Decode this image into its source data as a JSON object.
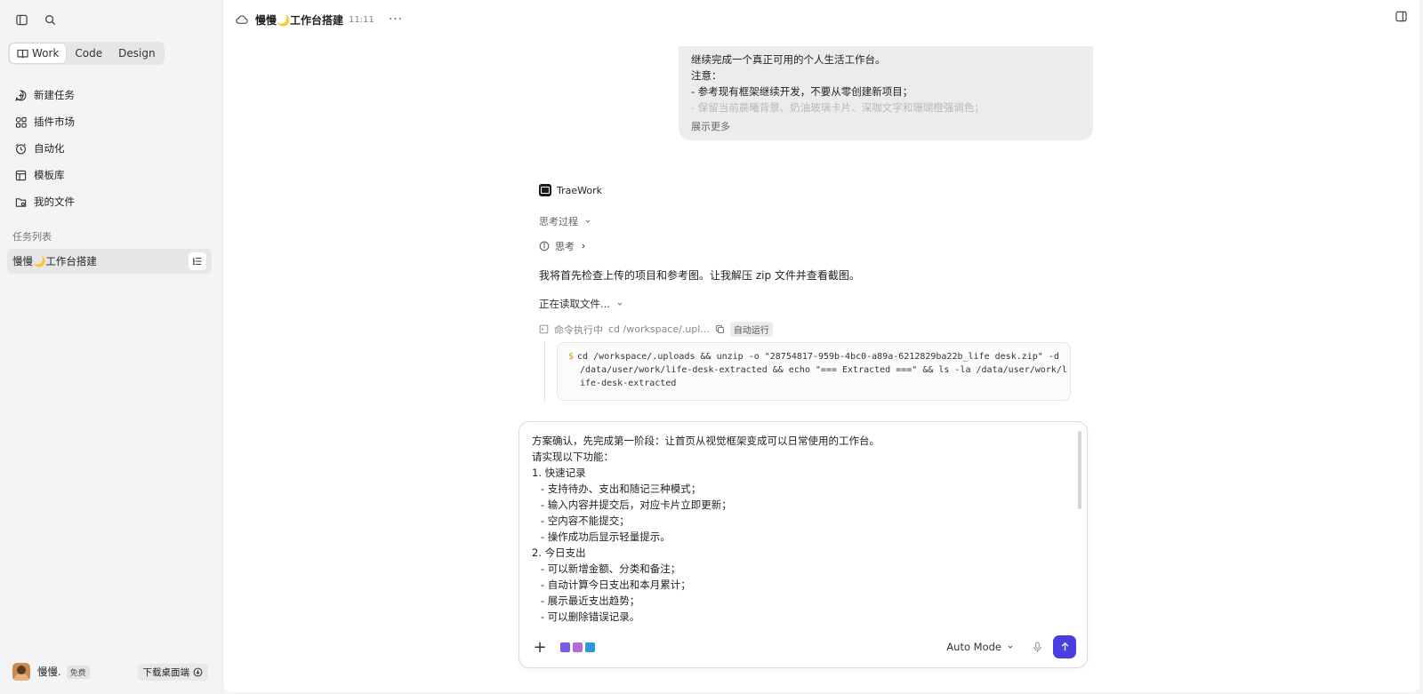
{
  "sidebar": {
    "tabs": [
      {
        "label": "Work",
        "active": true
      },
      {
        "label": "Code",
        "active": false
      },
      {
        "label": "Design",
        "active": false
      }
    ],
    "nav": [
      {
        "label": "新建任务",
        "icon": "new-task-icon"
      },
      {
        "label": "插件市场",
        "icon": "plugin-icon"
      },
      {
        "label": "自动化",
        "icon": "clock-icon"
      },
      {
        "label": "模板库",
        "icon": "template-icon"
      },
      {
        "label": "我的文件",
        "icon": "folder-icon"
      }
    ],
    "section_title": "任务列表",
    "task": "慢慢🌙工作台搭建",
    "user": {
      "name": "慢慢.",
      "plan": "免费"
    },
    "download": "下载桌面端"
  },
  "header": {
    "title": "慢慢🌙工作台搭建",
    "time": "11:11",
    "more": "···"
  },
  "user_message": {
    "lines": [
      "继续完成一个真正可用的个人生活工作台。",
      "注意：",
      "- 参考现有框架继续开发，不要从零创建新项目；",
      "- 保留当前晨曦背景、奶油玻璃卡片、深咖文字和珊瑚橙强调色；"
    ],
    "show_more": "展示更多"
  },
  "assistant": {
    "brand": "TraeWork",
    "thinking_process": "思考过程",
    "think": "思考",
    "reply": "我将首先检查上传的项目和参考图。让我解压 zip 文件并查看截图。",
    "reading": "正在读取文件...",
    "command": {
      "status": "命令执行中",
      "preview": "cd /workspace/.upl...",
      "auto": "自动运行",
      "code_lines": [
        "cd /workspace/.uploads && unzip -o \"28754817-959b-4bc0-a89a-6212829ba22b_life desk.zip\" -d",
        "/data/user/work/life-desk-extracted && echo \"=== Extracted ===\" && ls -la /data/user/work/l",
        "ife-desk-extracted"
      ]
    }
  },
  "composer": {
    "lines": [
      {
        "text": "方案确认，先完成第一阶段：让首页从视觉框架变成可以日常使用的工作台。",
        "sub": false
      },
      {
        "text": "请实现以下功能：",
        "sub": false
      },
      {
        "text": "1. 快速记录",
        "sub": false
      },
      {
        "text": "- 支持待办、支出和随记三种模式；",
        "sub": true
      },
      {
        "text": "- 输入内容并提交后，对应卡片立即更新；",
        "sub": true
      },
      {
        "text": "- 空内容不能提交；",
        "sub": true
      },
      {
        "text": "- 操作成功后显示轻量提示。",
        "sub": true
      },
      {
        "text": "2. 今日支出",
        "sub": false
      },
      {
        "text": "- 可以新增金额、分类和备注；",
        "sub": true
      },
      {
        "text": "- 自动计算今日支出和本月累计；",
        "sub": true
      },
      {
        "text": "- 展示最近支出趋势；",
        "sub": true
      },
      {
        "text": "- 可以删除错误记录。",
        "sub": true
      }
    ],
    "mode": "Auto Mode",
    "accent": "#4a3ee0"
  }
}
